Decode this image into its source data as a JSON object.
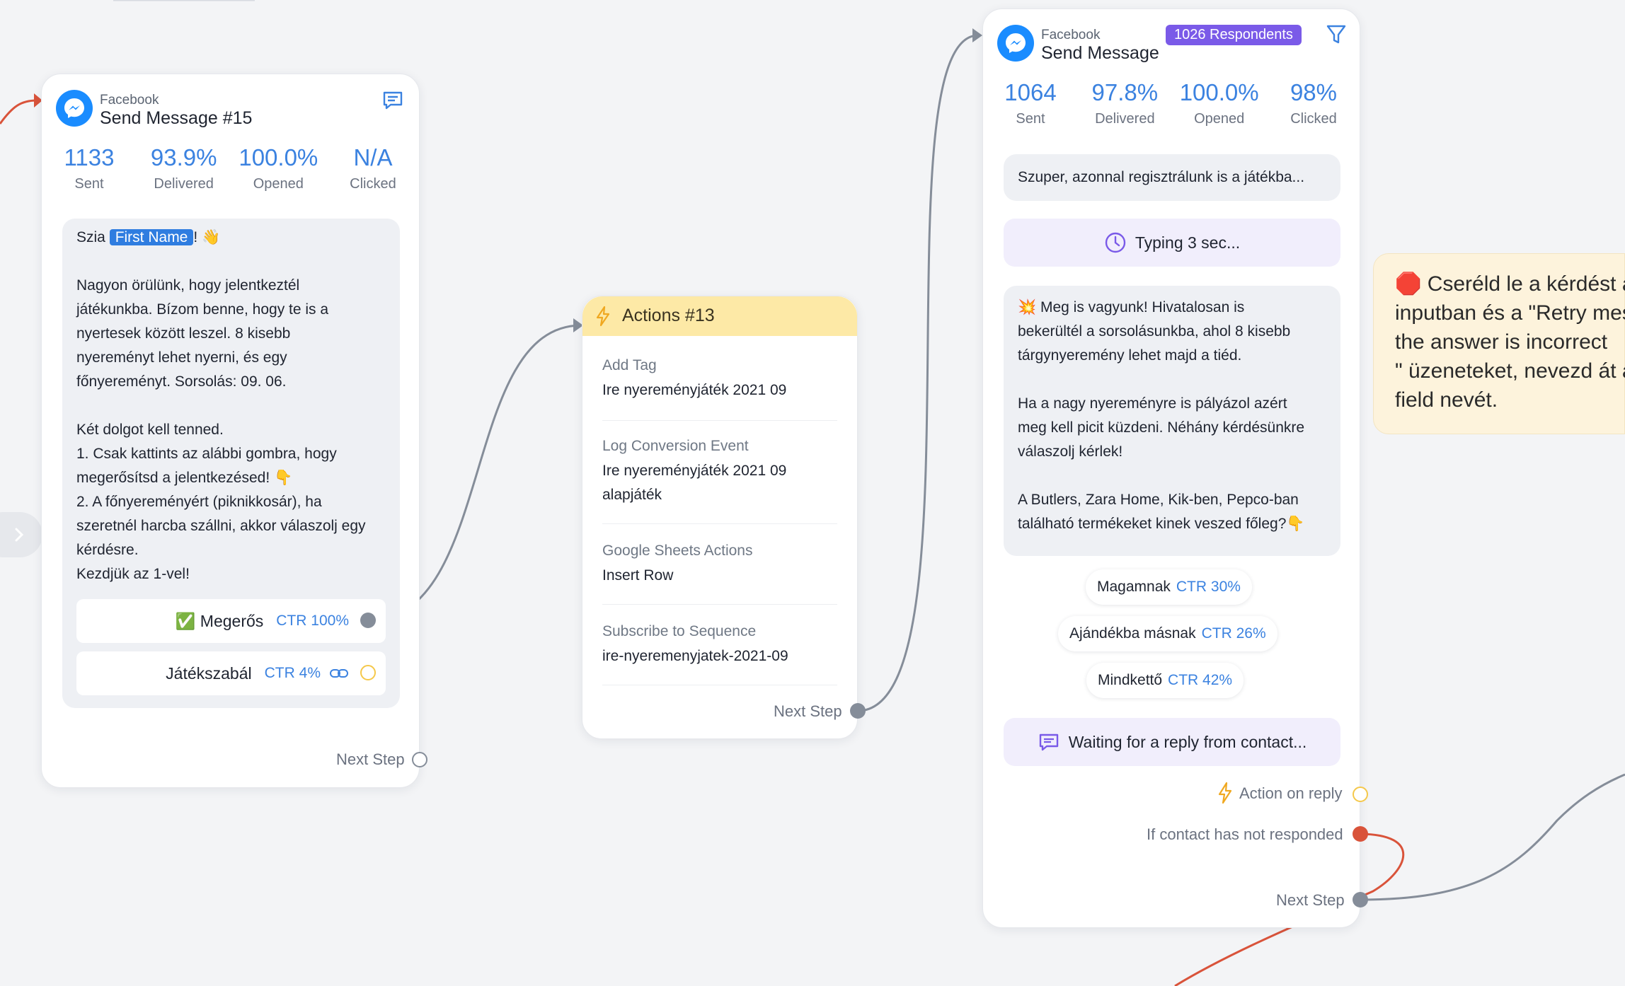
{
  "card_left": {
    "platform": "Facebook",
    "title": "Send Message #15",
    "stats": [
      {
        "value": "1133",
        "label": "Sent"
      },
      {
        "value": "93.9%",
        "label": "Delivered"
      },
      {
        "value": "100.0%",
        "label": "Opened"
      },
      {
        "value": "N/A",
        "label": "Clicked"
      }
    ],
    "greeting_prefix": "Szia ",
    "first_name_chip": "First Name",
    "greeting_suffix": "! 👋",
    "body": "\nNagyon örülünk, hogy jelentkeztél\njátékunkba. Bízom benne, hogy te is a\nnyertesek között leszel. 8 kisebb\nnyereményt lehet nyerni, és egy\nfőnyereményt. Sorsolás: 09. 06.\n\nKét dolgot kell tenned.\n1. Csak kattints az alábbi gombra, hogy\nmegerősítsd a jelentkezésed! 👇\n2. A főnyereményért (piknikkosár), ha\nszeretnél harcba szállni, akkor válaszolj egy\nkérdésre.\nKezdjük az 1-vel!",
    "buttons": [
      {
        "label": "✅ Megerős",
        "ctr": "CTR 100%"
      },
      {
        "label": "Játékszabál",
        "ctr": "CTR 4%"
      }
    ],
    "next_step": "Next Step"
  },
  "actions_card": {
    "title": "Actions #13",
    "items": [
      {
        "key": "Add Tag",
        "value": "Ire nyereményjáték 2021 09"
      },
      {
        "key": "Log Conversion Event",
        "value": "Ire nyereményjáték 2021 09\nalapjáték"
      },
      {
        "key": "Google Sheets Actions",
        "value": "Insert Row"
      },
      {
        "key": "Subscribe to Sequence",
        "value": "ire-nyeremenyjatek-2021-09"
      }
    ],
    "next_step": "Next Step"
  },
  "card_right": {
    "platform": "Facebook",
    "title": "Send Message",
    "respondents_badge": "1026 Respondents",
    "stats": [
      {
        "value": "1064",
        "label": "Sent"
      },
      {
        "value": "97.8%",
        "label": "Delivered"
      },
      {
        "value": "100.0%",
        "label": "Opened"
      },
      {
        "value": "98%",
        "label": "Clicked"
      }
    ],
    "preview_text": "Szuper, azonnal regisztrálunk is a játékba...",
    "typing": "Typing 3 sec...",
    "message": "💥 Meg is vagyunk! Hivatalosan is\nbekerültél a sorsolásunkba, ahol 8 kisebb\ntárgynyeremény lehet majd a tiéd.\n\nHa a nagy nyereményre is pályázol azért\nmeg kell picit küzdeni. Néhány kérdésünkre\nválaszolj kérlek!\n\nA Butlers, Zara Home, Kik-ben, Pepco-ban\ntalálható termékeket kinek veszed főleg?👇",
    "quick_replies": [
      {
        "label": "Magamnak",
        "ctr": "CTR 30%"
      },
      {
        "label": "Ajándékba másnak",
        "ctr": "CTR 26%"
      },
      {
        "label": "Mindkettő",
        "ctr": "CTR 42%"
      }
    ],
    "waiting": "Waiting for a reply from contact...",
    "action_on_reply": "Action on reply",
    "not_responded": "If contact has not responded",
    "next_step": "Next Step"
  },
  "note": {
    "text": "🛑 Cseréld le a kérdést a\ninputban és a \"Retry mes\nthe answer is incorrect\n\" üzeneteket, nevezd át a\nfield nevét."
  },
  "colors": {
    "accent_blue": "#3b82e0",
    "messenger_blue": "#1a8cff",
    "actions_yellow": "#fde9a6",
    "badge_purple": "#7a5ae8",
    "wire_gray": "#858d99",
    "wire_red": "#d9533a"
  }
}
